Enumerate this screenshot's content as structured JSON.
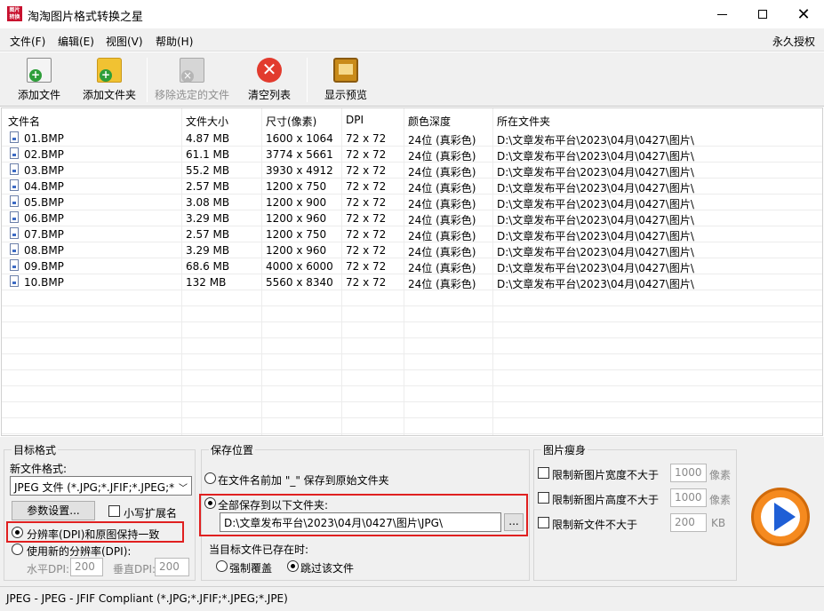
{
  "window": {
    "icon_text": "图片\n转换",
    "title": "淘淘图片格式转换之星"
  },
  "menu": {
    "items": [
      "文件(F)",
      "编辑(E)",
      "视图(V)",
      "帮助(H)"
    ],
    "right": "永久授权"
  },
  "toolbar": {
    "add_file": "添加文件",
    "add_folder": "添加文件夹",
    "remove_selected": "移除选定的文件",
    "clear_list": "清空列表",
    "show_preview": "显示预览"
  },
  "file_list": {
    "columns": [
      "文件名",
      "文件大小",
      "尺寸(像素)",
      "DPI",
      "颜色深度",
      "所在文件夹"
    ],
    "rows": [
      [
        "01.BMP",
        "4.87 MB",
        "1600 x 1064",
        "72 x 72",
        "24位 (真彩色)",
        "D:\\文章发布平台\\2023\\04月\\0427\\图片\\"
      ],
      [
        "02.BMP",
        "61.1 MB",
        "3774 x 5661",
        "72 x 72",
        "24位 (真彩色)",
        "D:\\文章发布平台\\2023\\04月\\0427\\图片\\"
      ],
      [
        "03.BMP",
        "55.2 MB",
        "3930 x 4912",
        "72 x 72",
        "24位 (真彩色)",
        "D:\\文章发布平台\\2023\\04月\\0427\\图片\\"
      ],
      [
        "04.BMP",
        "2.57 MB",
        "1200 x 750",
        "72 x 72",
        "24位 (真彩色)",
        "D:\\文章发布平台\\2023\\04月\\0427\\图片\\"
      ],
      [
        "05.BMP",
        "3.08 MB",
        "1200 x 900",
        "72 x 72",
        "24位 (真彩色)",
        "D:\\文章发布平台\\2023\\04月\\0427\\图片\\"
      ],
      [
        "06.BMP",
        "3.29 MB",
        "1200 x 960",
        "72 x 72",
        "24位 (真彩色)",
        "D:\\文章发布平台\\2023\\04月\\0427\\图片\\"
      ],
      [
        "07.BMP",
        "2.57 MB",
        "1200 x 750",
        "72 x 72",
        "24位 (真彩色)",
        "D:\\文章发布平台\\2023\\04月\\0427\\图片\\"
      ],
      [
        "08.BMP",
        "3.29 MB",
        "1200 x 960",
        "72 x 72",
        "24位 (真彩色)",
        "D:\\文章发布平台\\2023\\04月\\0427\\图片\\"
      ],
      [
        "09.BMP",
        "68.6 MB",
        "4000 x 6000",
        "72 x 72",
        "24位 (真彩色)",
        "D:\\文章发布平台\\2023\\04月\\0427\\图片\\"
      ],
      [
        "10.BMP",
        "132 MB",
        "5560 x 8340",
        "72 x 72",
        "24位 (真彩色)",
        "D:\\文章发布平台\\2023\\04月\\0427\\图片\\"
      ]
    ]
  },
  "target_format": {
    "group_title": "目标格式",
    "new_format_label": "新文件格式:",
    "format_value": "JPEG 文件 (*.JPG;*.JFIF;*.JPEG;*",
    "params_button": "参数设置...",
    "lowercase_ext": "小写扩展名",
    "keep_dpi": "分辨率(DPI)和原图保持一致",
    "use_new_dpi": "使用新的分辨率(DPI):",
    "h_dpi_label": "水平DPI:",
    "h_dpi_value": "200",
    "v_dpi_label": "垂直DPI:",
    "v_dpi_value": "200"
  },
  "save_location": {
    "group_title": "保存位置",
    "prefix_option": "在文件名前加 \"_\" 保存到原始文件夹",
    "folder_option": "全部保存到以下文件夹:",
    "folder_path": "D:\\文章发布平台\\2023\\04月\\0427\\图片\\JPG\\",
    "browse_button": "...",
    "exists_label": "当目标文件已存在时:",
    "overwrite": "强制覆盖",
    "skip": "跳过该文件"
  },
  "slim": {
    "group_title": "图片瘦身",
    "limit_width": "限制新图片宽度不大于",
    "width_value": "1000",
    "width_unit": "像素",
    "limit_height": "限制新图片高度不大于",
    "height_value": "1000",
    "height_unit": "像素",
    "limit_size": "限制新文件不大于",
    "size_value": "200",
    "size_unit": "KB"
  },
  "status": {
    "text": "JPEG - JPEG - JFIF Compliant (*.JPG;*.JFIF;*.JPEG;*.JPE)"
  },
  "colors": {
    "highlight_box": "#e02020",
    "start_button": "#f58a1f",
    "start_arrow": "#1f5fd6"
  }
}
